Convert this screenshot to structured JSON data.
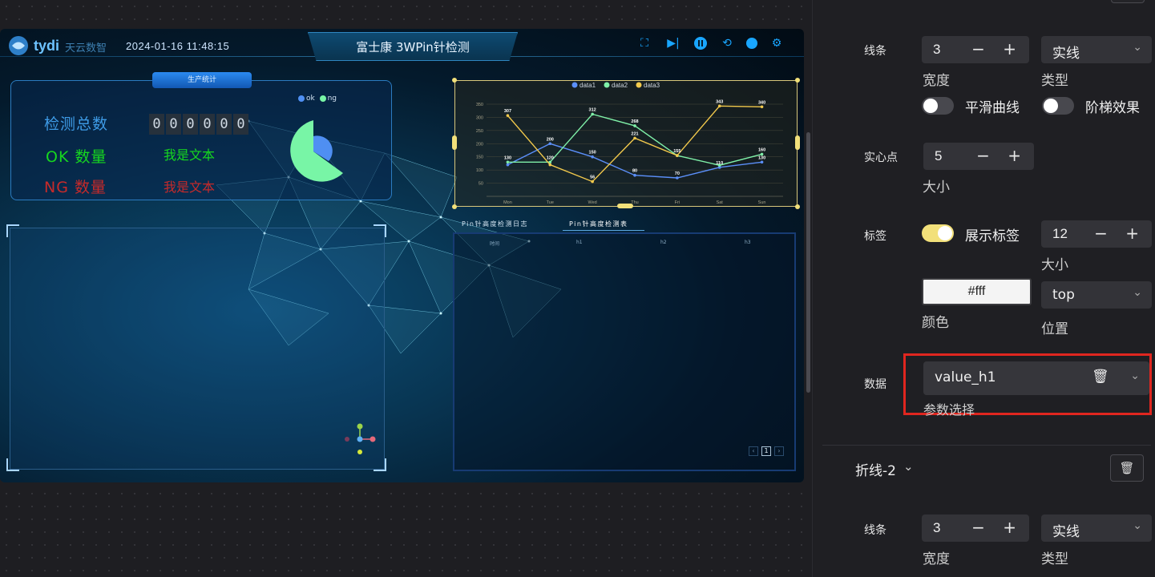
{
  "dashboard": {
    "logo": "tydi",
    "logo_sub": "天云数智",
    "datetime": "2024-01-16 11:48:15",
    "title": "富士康 3WPin针检测",
    "toolbar_icons": [
      "fullscreen-icon",
      "play-step-icon",
      "pause-icon",
      "refresh-icon",
      "record-icon",
      "gear-icon"
    ],
    "stats_panel": {
      "tab": "生产统计",
      "total_label": "检测总数",
      "digits": [
        "0",
        "0",
        "0",
        "0",
        "0",
        "0"
      ],
      "ok_label": "OK 数量",
      "ok_value": "我是文本",
      "ng_label": "NG 数量",
      "ng_value": "我是文本",
      "pie_legend": [
        "ok",
        "ng"
      ],
      "colors": {
        "total": "#3e9be6",
        "ok": "#16d71f",
        "ng": "#c72a2a",
        "pie_ok": "#78f5a6",
        "pie_ng": "#4f8ff2"
      }
    },
    "table_tabs": [
      "Pin针高度检测日志",
      "Pin针高度检测表"
    ],
    "table_headers": [
      "时间",
      "h1",
      "h2",
      "h3"
    ],
    "pagination": {
      "prev": "‹",
      "page": "1",
      "next": "›"
    }
  },
  "chart_data": {
    "type": "line",
    "categories": [
      "Mon",
      "Tue",
      "Wed",
      "Thu",
      "Fri",
      "Sat",
      "Sun"
    ],
    "ylim": [
      0,
      350
    ],
    "yticks": [
      50,
      100,
      150,
      200,
      250,
      300,
      350
    ],
    "legend": [
      "data1",
      "data2",
      "data3"
    ],
    "series": [
      {
        "name": "data1",
        "color": "#5b8ff9",
        "values": [
          120,
          200,
          150,
          80,
          70,
          110,
          130
        ]
      },
      {
        "name": "data2",
        "color": "#7ff0a8",
        "values": [
          130,
          130,
          312,
          268,
          155,
          118,
          160
        ]
      },
      {
        "name": "data3",
        "color": "#f2c94c",
        "values": [
          307,
          120,
          56,
          221,
          155,
          343,
          340
        ]
      }
    ],
    "data_labels": [
      {
        "series": 2,
        "index": 0,
        "text": "307"
      },
      {
        "series": 1,
        "index": 0,
        "text": "130"
      },
      {
        "series": 0,
        "index": 1,
        "text": "200"
      },
      {
        "series": 1,
        "index": 1,
        "text": "120"
      },
      {
        "series": 1,
        "index": 2,
        "text": "312"
      },
      {
        "series": 0,
        "index": 2,
        "text": "150"
      },
      {
        "series": 2,
        "index": 2,
        "text": "56"
      },
      {
        "series": 1,
        "index": 3,
        "text": "268"
      },
      {
        "series": 2,
        "index": 3,
        "text": "221"
      },
      {
        "series": 0,
        "index": 3,
        "text": "80"
      },
      {
        "series": 2,
        "index": 4,
        "text": "155"
      },
      {
        "series": 0,
        "index": 4,
        "text": "70"
      },
      {
        "series": 2,
        "index": 5,
        "text": "343"
      },
      {
        "series": 0,
        "index": 5,
        "text": "110"
      },
      {
        "series": 2,
        "index": 6,
        "text": "340"
      },
      {
        "series": 1,
        "index": 6,
        "text": "160"
      },
      {
        "series": 0,
        "index": 6,
        "text": "130"
      }
    ]
  },
  "props": {
    "line": {
      "label": "线条",
      "width_value": "3",
      "width_label": "宽度",
      "type_value": "实线",
      "type_label": "类型"
    },
    "smooth_label": "平滑曲线",
    "step_label": "阶梯效果",
    "point": {
      "label": "实心点",
      "size_value": "5",
      "size_label": "大小"
    },
    "tag": {
      "label": "标签",
      "show_label": "展示标签",
      "show_on": true,
      "size_value": "12",
      "size_label": "大小",
      "color_value": "#fff",
      "color_label": "颜色",
      "position_value": "top",
      "position_label": "位置"
    },
    "data": {
      "label": "数据",
      "param_value": "value_h1",
      "param_label": "参数选择",
      "highlight_color": "#e0261f"
    },
    "section2": {
      "title": "折线-2"
    },
    "line2": {
      "label": "线条",
      "width_value": "3",
      "width_label": "宽度",
      "type_value": "实线",
      "type_label": "类型"
    },
    "stepper_text": "− +"
  }
}
